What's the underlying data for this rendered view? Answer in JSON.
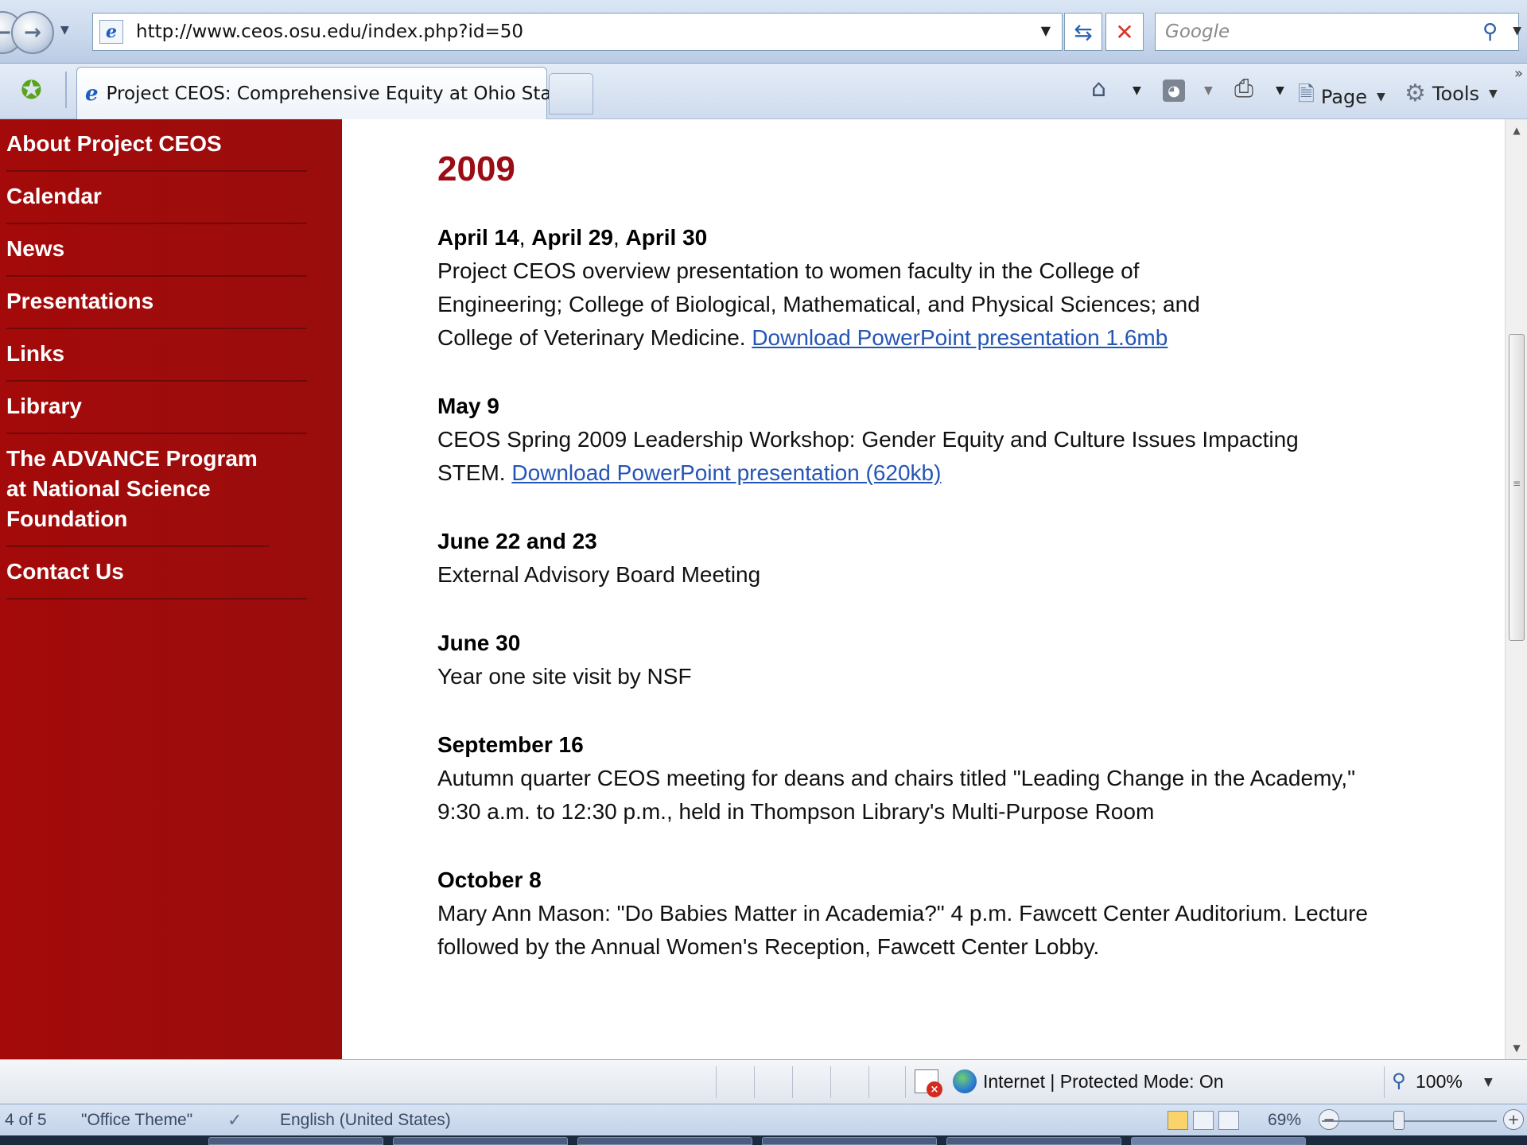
{
  "browser": {
    "url": "http://www.ceos.osu.edu/index.php?id=50",
    "search_placeholder": "Google",
    "tab_title": "Project CEOS: Comprehensive Equity at Ohio Stat...",
    "commands": {
      "page_label": "Page",
      "tools_label": "Tools"
    },
    "status": {
      "zone_text": "Internet | Protected Mode: On",
      "zoom": "100%"
    }
  },
  "sidebar": {
    "items": [
      {
        "label": "About Project CEOS"
      },
      {
        "label": "Calendar"
      },
      {
        "label": "News"
      },
      {
        "label": "Presentations"
      },
      {
        "label": "Links"
      },
      {
        "label": "Library"
      },
      {
        "label": "The ADVANCE Program at National Science Foundation"
      },
      {
        "label": "Contact Us"
      }
    ]
  },
  "main": {
    "year": "2009",
    "events": [
      {
        "date_parts": [
          "April 14",
          ", ",
          "April 29",
          ", ",
          "April 30"
        ],
        "description": "Project CEOS overview presentation to women faculty in the College of Engineering; College of Biological, Mathematical, and Physical Sciences; and College of Veterinary Medicine. ",
        "link": "Download PowerPoint presentation 1.6mb"
      },
      {
        "date": "May 9",
        "description": "CEOS Spring 2009 Leadership Workshop: Gender Equity and Culture Issues Impacting STEM. ",
        "link": "Download PowerPoint presentation (620kb)"
      },
      {
        "date": "June 22 and 23",
        "description": "External Advisory Board Meeting"
      },
      {
        "date": "June 30",
        "description": "Year one site visit by NSF"
      },
      {
        "date": "September 16",
        "description": "Autumn quarter CEOS meeting for deans and chairs titled \"Leading Change in the Academy,\" 9:30 a.m. to 12:30 p.m., held in Thompson Library's Multi-Purpose Room"
      },
      {
        "date": "October 8",
        "description": "Mary Ann Mason: \"Do Babies Matter in Academia?\" 4 p.m. Fawcett Center Auditorium. Lecture followed by the Annual Women's Reception, Fawcett Center Lobby."
      }
    ]
  },
  "office_status": {
    "slide_count": "4 of 5",
    "theme": "\"Office Theme\"",
    "language": "English (United States)",
    "zoom": "69%"
  },
  "colors": {
    "sidebar_bg": "#a40a0a",
    "heading": "#9b0d15",
    "link": "#2555b5"
  }
}
